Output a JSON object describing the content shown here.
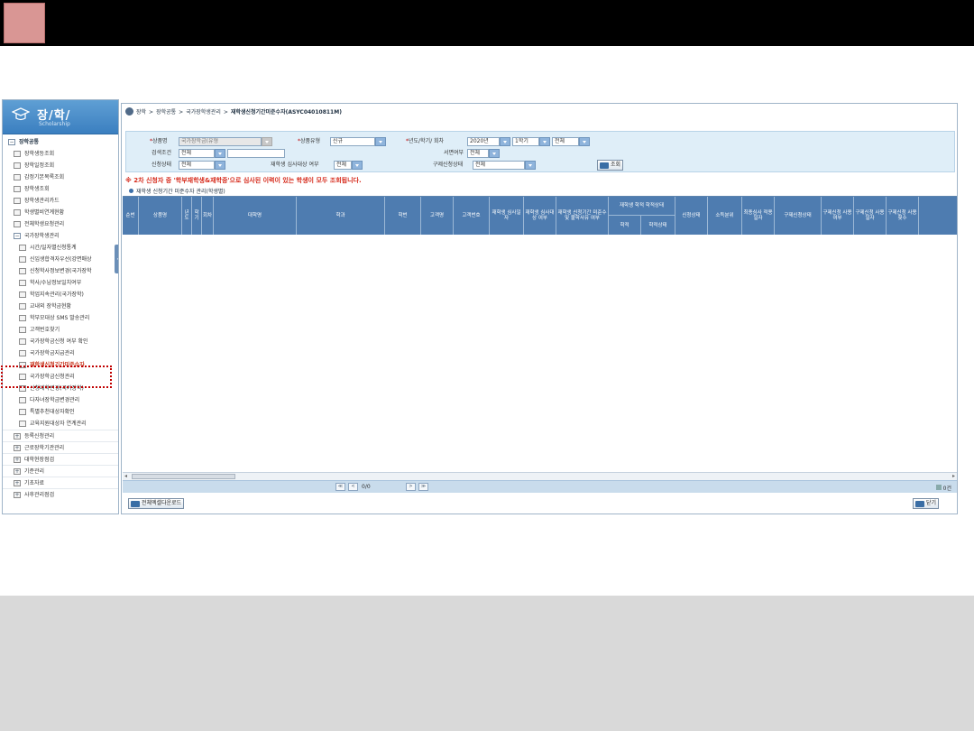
{
  "sidebar": {
    "logo_title": "장/학/",
    "logo_sub": "Scholarship",
    "items": [
      {
        "label": "장학공통",
        "kind": "top",
        "indent": 0
      },
      {
        "label": "장학생등조회",
        "kind": "leaf",
        "indent": 1
      },
      {
        "label": "장학일정조회",
        "kind": "leaf",
        "indent": 1
      },
      {
        "label": "감정기본목록조회",
        "kind": "leaf",
        "indent": 1
      },
      {
        "label": "장학생조회",
        "kind": "leaf",
        "indent": 1
      },
      {
        "label": "장학생관리카드",
        "kind": "leaf",
        "indent": 1
      },
      {
        "label": "학생별비연계현황",
        "kind": "leaf",
        "indent": 1
      },
      {
        "label": "전체학생요청관리",
        "kind": "leaf",
        "indent": 1
      },
      {
        "label": "국가장학생관리",
        "kind": "grp",
        "indent": 1
      },
      {
        "label": "시간/일자별신청통계",
        "kind": "leaf",
        "indent": 2
      },
      {
        "label": "신입생합격자우선(강면매상",
        "kind": "leaf",
        "indent": 2
      },
      {
        "label": "신청학사정보변경(국가장학",
        "kind": "leaf",
        "indent": 2
      },
      {
        "label": "학사/수납정보일치여부",
        "kind": "leaf",
        "indent": 2
      },
      {
        "label": "학업지속관리(국가장학)",
        "kind": "leaf",
        "indent": 2
      },
      {
        "label": "교내외 장학금현황",
        "kind": "leaf",
        "indent": 2
      },
      {
        "label": "학부모대상 SMS 발송관리",
        "kind": "leaf",
        "indent": 2
      },
      {
        "label": "고객번호찾기",
        "kind": "leaf",
        "indent": 2
      },
      {
        "label": "국가장학금신청 여부 확인",
        "kind": "leaf",
        "indent": 2
      },
      {
        "label": "국가장학금지급관리",
        "kind": "leaf",
        "indent": 2
      },
      {
        "label": "재학생신청기간미준수자",
        "kind": "active",
        "indent": 2
      },
      {
        "label": "국가장학금신청관리",
        "kind": "leaf",
        "indent": 2
      },
      {
        "label": "신청대학변경(국가장학)",
        "kind": "leaf",
        "indent": 2
      },
      {
        "label": "다자녀장학금변경관리",
        "kind": "leaf",
        "indent": 2
      },
      {
        "label": "특별추천대상자확인",
        "kind": "leaf",
        "indent": 2
      },
      {
        "label": "교육지원대상자 연계관리",
        "kind": "leaf",
        "indent": 2
      },
      {
        "label": "등록신청관리",
        "kind": "plus",
        "indent": 1
      },
      {
        "label": "근로장학기관관리",
        "kind": "plus",
        "indent": 1
      },
      {
        "label": "대학현장점검",
        "kind": "plus",
        "indent": 1
      },
      {
        "label": "기준관리",
        "kind": "plus",
        "indent": 1
      },
      {
        "label": "기초자료",
        "kind": "plus",
        "indent": 1
      },
      {
        "label": "사후관리점검",
        "kind": "plus",
        "indent": 1
      }
    ]
  },
  "breadcrumb": {
    "items": [
      "장학",
      "장학공통",
      "국가장학생관리",
      "재학생신청기간미준수자(ASYC04010811M)"
    ],
    "separator": ">"
  },
  "search": {
    "product_label": "상품명",
    "product_value": "국가장학금(유형",
    "product_type_label": "상품유형",
    "product_type_value": "신규",
    "year_label": "년도/학기/ 회차",
    "year_value": "2020년",
    "term_value": "1학기",
    "round_value": "전체",
    "condition_label": "검색조건",
    "condition_value": "전체",
    "consent_label": "서면여부",
    "consent_value": "전체",
    "status_label": "신청상태",
    "status_value": "전체",
    "review_label": "재학생 심사대상 여부",
    "review_value": "전체",
    "detail_status_label": "구제신청상태",
    "detail_status_value": "전체",
    "search_button": "조회"
  },
  "notice": "※ 2차 신청자 중 '학부재학생&재학중'으로 심사된 이력이 있는 학생이 모두 조회됩니다.",
  "grid_title": "재학생 신청기간 미준수자 관리(학생별)",
  "grid": {
    "columns": [
      {
        "label": "순번"
      },
      {
        "label": "상품명"
      },
      {
        "label": "년도"
      },
      {
        "label": "학기"
      },
      {
        "label": "회차"
      },
      {
        "label": "대학명"
      },
      {
        "label": "학과"
      },
      {
        "label": "학번"
      },
      {
        "label": "고객명"
      },
      {
        "label": "고객번호"
      },
      {
        "label": "재학생 심사일자"
      },
      {
        "label": "재학생 심사대상 여부"
      },
      {
        "label": "재학생 신청기간 미준수 및 불학사유 여부"
      },
      {
        "label": "학적"
      },
      {
        "label": "학적상태"
      },
      {
        "label": "신청상태"
      },
      {
        "label": "소득분위"
      },
      {
        "label": "최종심사 적용일자"
      },
      {
        "label": "구제신청상태"
      },
      {
        "label": "구제신청 사용여부"
      },
      {
        "label": "구제신청 사용일자"
      },
      {
        "label": "구제신청 사용횟수"
      }
    ],
    "group_header": "재학생 학적 학적상태",
    "rows": []
  },
  "pager": {
    "page_info": "0/0",
    "total": "0건",
    "first": "≪",
    "prev": "<",
    "next": ">",
    "last": "≫"
  },
  "footer": {
    "download_button": "전체엑셀다운로드",
    "close_button": "닫기"
  },
  "colors": {
    "header_bg": "#4e7cb0",
    "search_bg": "#dfeef8",
    "notice": "#d62b1c",
    "highlight": "#c00000",
    "topbar": "#000000",
    "accent_square": "#d99694"
  }
}
